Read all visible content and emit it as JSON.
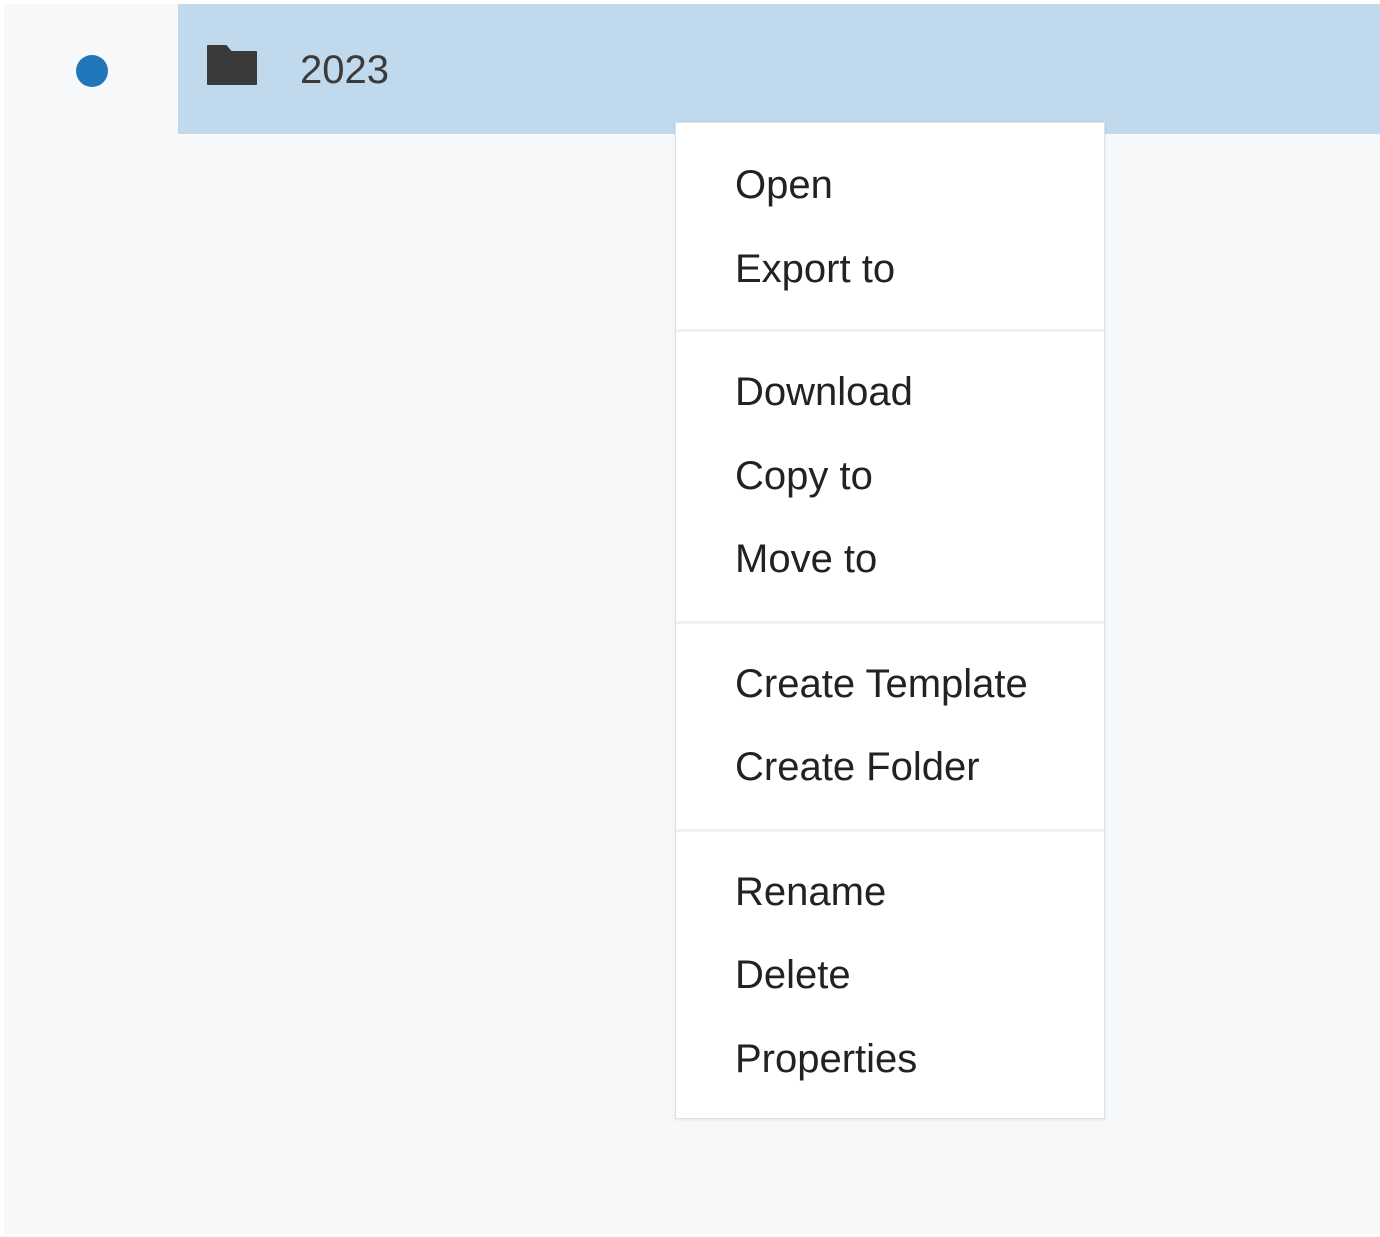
{
  "row": {
    "folder_name": "2023",
    "icon": "folder-icon",
    "status_icon": "status-dot-icon"
  },
  "colors": {
    "selection": "#c0d9ec",
    "status_dot": "#1f77b9",
    "background": "#f6f8fa"
  },
  "context_menu": {
    "groups": [
      {
        "items": [
          "Open",
          "Export to"
        ]
      },
      {
        "items": [
          "Download",
          "Copy to",
          "Move to"
        ]
      },
      {
        "items": [
          "Create Template",
          "Create Folder"
        ]
      },
      {
        "items": [
          "Rename",
          "Delete",
          "Properties"
        ]
      }
    ]
  }
}
